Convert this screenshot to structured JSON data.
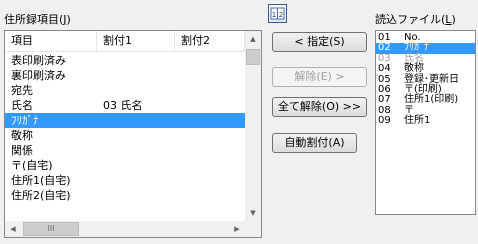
{
  "left_label": "住所録項目(",
  "left_label_key": "J",
  "left_label_end": ")",
  "right_label": "読込ファイル(",
  "right_label_key": "L",
  "right_label_end": ")",
  "switch_icon_text": "1|2",
  "left_columns": [
    "項目",
    "割付1",
    "割付2"
  ],
  "left_rows": [
    {
      "item": "表印刷済み",
      "a1": "",
      "a2": ""
    },
    {
      "item": "裏印刷済み",
      "a1": "",
      "a2": ""
    },
    {
      "item": "宛先",
      "a1": "",
      "a2": ""
    },
    {
      "item": "氏名",
      "a1": "03 氏名",
      "a2": ""
    },
    {
      "item": "ﾌﾘｶﾞﾅ",
      "a1": "",
      "a2": "",
      "selected": true
    },
    {
      "item": "敬称",
      "a1": "",
      "a2": ""
    },
    {
      "item": "関係",
      "a1": "",
      "a2": ""
    },
    {
      "item": "〒(自宅)",
      "a1": "",
      "a2": ""
    },
    {
      "item": "住所1(自宅)",
      "a1": "",
      "a2": ""
    },
    {
      "item": "住所2(自宅)",
      "a1": "",
      "a2": ""
    }
  ],
  "buttons": {
    "assign": "< 指定(S)",
    "release": "解除(E) >",
    "release_all": "全て解除(O) >>",
    "auto_assign": "自動割付(A)"
  },
  "right_rows": [
    {
      "num": "01",
      "text": "No."
    },
    {
      "num": "02",
      "text": "ﾌﾘｶﾞﾅ",
      "selected": true
    },
    {
      "num": "03",
      "text": "氏名",
      "dim": true
    },
    {
      "num": "04",
      "text": "敬称"
    },
    {
      "num": "05",
      "text": "登録･更新日"
    },
    {
      "num": "06",
      "text": "〒(印刷)"
    },
    {
      "num": "07",
      "text": "住所1(印刷)"
    },
    {
      "num": "08",
      "text": "〒"
    },
    {
      "num": "09",
      "text": "住所1"
    }
  ],
  "scroll": {
    "up_arrow": "▲",
    "down_arrow": "▼",
    "left_arrow": "◀",
    "right_arrow": "▶",
    "thumb_grip": "III"
  }
}
